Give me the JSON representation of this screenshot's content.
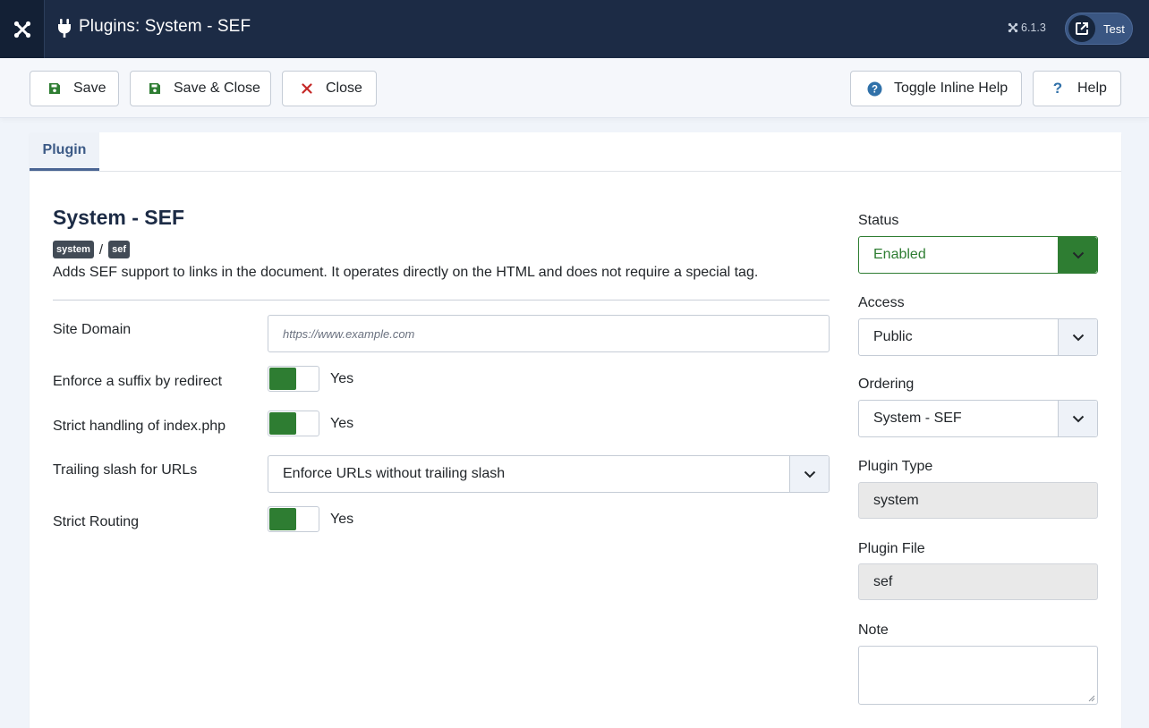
{
  "header": {
    "title": "Plugins: System - SEF",
    "version": "6.1.3",
    "user_label": "Test"
  },
  "toolbar": {
    "save": "Save",
    "save_close": "Save & Close",
    "close": "Close",
    "toggle_help": "Toggle Inline Help",
    "help": "Help"
  },
  "tabs": [
    {
      "label": "Plugin",
      "active": true
    }
  ],
  "plugin": {
    "title": "System - SEF",
    "tags": [
      "system",
      "sef"
    ],
    "tag_separator": "/",
    "description": "Adds SEF support to links in the document. It operates directly on the HTML and does not require a special tag."
  },
  "fields": {
    "site_domain": {
      "label": "Site Domain",
      "placeholder": "https://www.example.com"
    },
    "enforce_suffix": {
      "label": "Enforce a suffix by redirect",
      "value": "Yes"
    },
    "strict_index": {
      "label": "Strict handling of index.php",
      "value": "Yes"
    },
    "trailing_slash": {
      "label": "Trailing slash for URLs",
      "value": "Enforce URLs without trailing slash"
    },
    "strict_routing": {
      "label": "Strict Routing",
      "value": "Yes"
    }
  },
  "sidebar": {
    "status": {
      "label": "Status",
      "value": "Enabled"
    },
    "access": {
      "label": "Access",
      "value": "Public"
    },
    "ordering": {
      "label": "Ordering",
      "value": "System - SEF"
    },
    "plugin_type": {
      "label": "Plugin Type",
      "value": "system"
    },
    "plugin_file": {
      "label": "Plugin File",
      "value": "sef"
    },
    "note": {
      "label": "Note",
      "value": ""
    }
  },
  "colors": {
    "header_bg": "#1c2b45",
    "accent_green": "#2e7d32",
    "tab_active": "#3c5a86",
    "danger_red": "#c52827",
    "help_blue": "#3071a9"
  },
  "icons": {
    "logo": "joomla-logo-icon",
    "header": "plug-icon",
    "version": "joomla-small-icon",
    "user": "external-link-icon",
    "save": "floppy-disk-icon",
    "close": "x-icon",
    "toggle_help": "question-circle-icon",
    "help": "question-mark-icon",
    "select": "chevron-down-icon"
  }
}
